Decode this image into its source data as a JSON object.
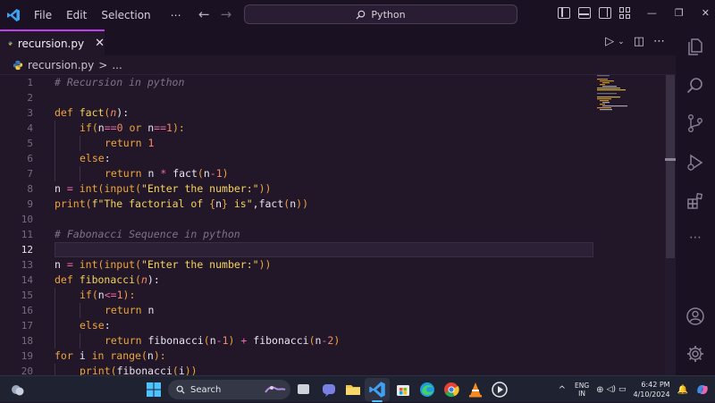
{
  "menu": [
    "File",
    "Edit",
    "Selection",
    "⋯"
  ],
  "command_center": {
    "label": "Python"
  },
  "tab": {
    "file_name": "recursion.py",
    "close": "✕"
  },
  "breadcrumb": {
    "file": "recursion.py",
    "sep": ">",
    "tail": "..."
  },
  "editor": {
    "active_line": 12,
    "line_numbers": [
      "1",
      "2",
      "3",
      "4",
      "5",
      "6",
      "7",
      "8",
      "9",
      "10",
      "11",
      "12",
      "13",
      "14",
      "15",
      "16",
      "17",
      "18",
      "19",
      "20"
    ],
    "lines": {
      "l1": "# Recursion in python",
      "l3": [
        "def",
        " ",
        "fact",
        "(",
        "n",
        "):"
      ],
      "l4": [
        "if",
        "(",
        "n",
        "==",
        "0",
        " or ",
        "n",
        "==",
        "1",
        "):"
      ],
      "l5": [
        "return",
        " ",
        "1"
      ],
      "l6": [
        "else",
        ":"
      ],
      "l7": [
        "return",
        " n ",
        "*",
        " ",
        "fact",
        "(",
        "n",
        "-",
        "1",
        ")"
      ],
      "l8": [
        "n ",
        "=",
        " ",
        "int",
        "(",
        "input",
        "(",
        "\"Enter the number:\"",
        "))"
      ],
      "l9": [
        "print",
        "(",
        "f\"The factorial of ",
        "{",
        "n",
        "}",
        " is\"",
        ",",
        "fact",
        "(",
        "n",
        "))"
      ],
      "l11": "# Fabonacci Sequence in python",
      "l13": [
        "n ",
        "=",
        " ",
        "int",
        "(",
        "input",
        "(",
        "\"Enter the number:\"",
        "))"
      ],
      "l14": [
        "def",
        " ",
        "fibonacci",
        "(",
        "n",
        "):"
      ],
      "l15": [
        "if",
        "(",
        "n",
        "<=",
        "1",
        "):"
      ],
      "l16": [
        "return",
        " n"
      ],
      "l17": [
        "else",
        ":"
      ],
      "l18": [
        "return",
        " ",
        "fibonacci",
        "(",
        "n",
        "-",
        "1",
        ")",
        " + ",
        "fibonacci",
        "(",
        "n",
        "-",
        "2",
        ")"
      ],
      "l19": [
        "for",
        " i ",
        "in",
        " ",
        "range",
        "(",
        "n",
        "):"
      ],
      "l20": [
        "print",
        "(",
        "fibonacci",
        "(",
        "i",
        "))"
      ]
    }
  },
  "taskbar": {
    "search_label": "Search",
    "lang_top": "ENG",
    "lang_bottom": "IN",
    "time": "6:42 PM",
    "date": "4/10/2024"
  },
  "colors": {
    "accent": "#c33cf0",
    "background": "#211729"
  }
}
